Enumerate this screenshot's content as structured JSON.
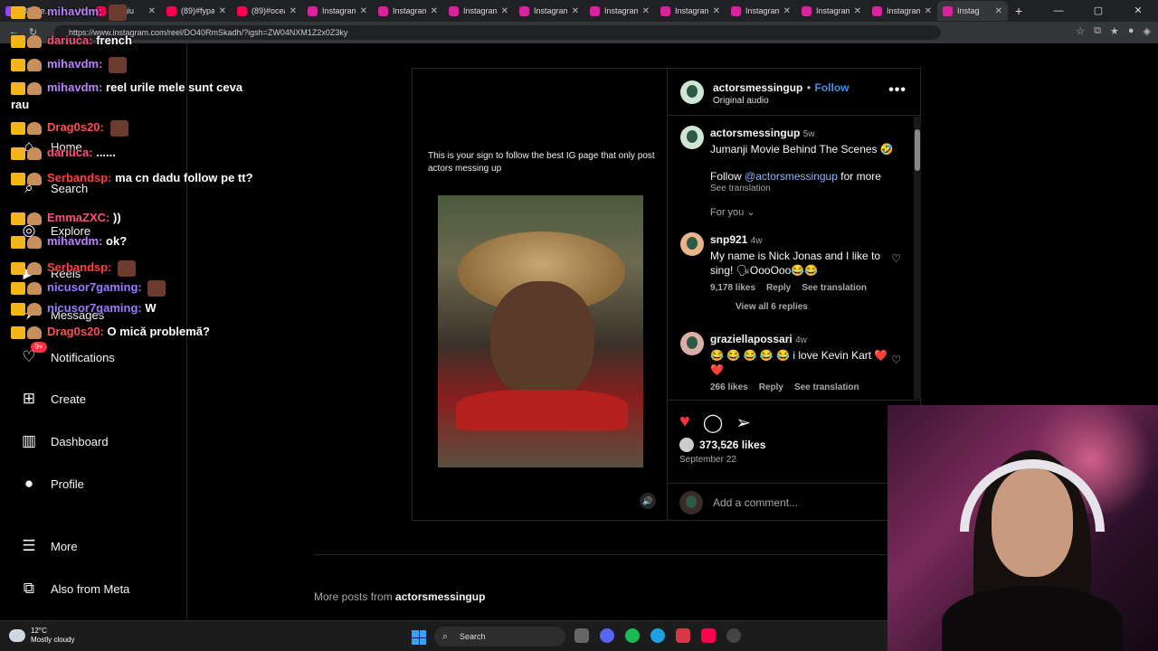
{
  "browser": {
    "tabs": [
      {
        "label": "(88)Ne...",
        "color": "#9146ff"
      },
      {
        "label": "Sergiu",
        "color": "#ff0050"
      },
      {
        "label": "(89)#fypag",
        "color": "#ff0050"
      },
      {
        "label": "(89)#ocea",
        "color": "#ff0050"
      },
      {
        "label": "Instagram",
        "color": "#d6249f"
      },
      {
        "label": "Instagram",
        "color": "#d6249f"
      },
      {
        "label": "Instagram",
        "color": "#d6249f"
      },
      {
        "label": "Instagram",
        "color": "#d6249f"
      },
      {
        "label": "Instagram",
        "color": "#d6249f"
      },
      {
        "label": "Instagram",
        "color": "#d6249f"
      },
      {
        "label": "Instagram",
        "color": "#d6249f"
      },
      {
        "label": "Instagram",
        "color": "#d6249f"
      },
      {
        "label": "Instagram",
        "color": "#d6249f"
      },
      {
        "label": "Instag",
        "color": "#d6249f"
      }
    ],
    "new_tab": "+",
    "url": "https://www.instagram.com/reel/DO40RmSkadh/?igsh=ZW04NXM1Z2x0Z3ky"
  },
  "sidebar": {
    "logo": "Instagram",
    "items": [
      {
        "label": "Home",
        "icon": "home-icon",
        "glyph": "⌂"
      },
      {
        "label": "Search",
        "icon": "search-icon",
        "glyph": "⌕"
      },
      {
        "label": "Explore",
        "icon": "explore-icon",
        "glyph": "◎"
      },
      {
        "label": "Reels",
        "icon": "reels-icon",
        "glyph": "▶"
      },
      {
        "label": "Messages",
        "icon": "messages-icon",
        "glyph": "✈"
      },
      {
        "label": "Notifications",
        "icon": "heart-icon",
        "glyph": "♡"
      },
      {
        "label": "Create",
        "icon": "plus-square-icon",
        "glyph": "⊞"
      },
      {
        "label": "Dashboard",
        "icon": "dashboard-icon",
        "glyph": "▥"
      },
      {
        "label": "Profile",
        "icon": "avatar-icon",
        "glyph": "●"
      },
      {
        "label": "More",
        "icon": "menu-icon",
        "glyph": "☰"
      },
      {
        "label": "Also from Meta",
        "icon": "meta-icon",
        "glyph": "⧉"
      }
    ],
    "messages_badge": "9+"
  },
  "chat": [
    {
      "user": "mihavdm:",
      "text": "",
      "color": "#b983ff",
      "emote": true
    },
    {
      "user": "dariuca:",
      "text": "french",
      "color": "#ff4f7a",
      "emote": false
    },
    {
      "user": "mihavdm:",
      "text": "",
      "color": "#b983ff",
      "emote": true
    },
    {
      "user": "mihavdm:",
      "text": "reel urile mele sunt ceva rau",
      "color": "#b983ff",
      "emote": false
    },
    {
      "user": "Drag0s20:",
      "text": "",
      "color": "#ff4f4f",
      "emote": true
    },
    {
      "user": "dariuca:",
      "text": "......",
      "color": "#ff4f7a",
      "emote": false
    },
    {
      "user": "Serbandsp:",
      "text": "ma cn dadu follow pe tt?",
      "color": "#ff4040",
      "emote": false
    },
    {
      "user": "EmmaZXC:",
      "text": "))",
      "color": "#ff4f7a",
      "emote": false
    },
    {
      "user": "mihavdm:",
      "text": "ok?",
      "color": "#b983ff",
      "emote": false
    },
    {
      "user": "Serbandsp:",
      "text": "",
      "color": "#ff4040",
      "emote": true
    },
    {
      "user": "nicusor7gaming:",
      "text": "",
      "color": "#9a7cff",
      "emote": true
    },
    {
      "user": "nicusor7gaming:",
      "text": "W",
      "color": "#9a7cff",
      "emote": false
    },
    {
      "user": "Drag0s20:",
      "text": "O mică problemă?",
      "color": "#ff4f4f",
      "emote": false
    }
  ],
  "post": {
    "overlay_caption": "This is your sign to follow the best IG page that only post actors messing up",
    "username": "actorsmessingup",
    "follow": "Follow",
    "separator": "•",
    "audio": "Original audio",
    "more": "•••",
    "caption": {
      "username": "actorsmessingup",
      "age": "5w",
      "line1": "Jumanji Movie Behind The Scenes 🤣",
      "line2_prefix": "Follow ",
      "line2_mention": "@actorsmessingup",
      "line2_suffix": " for more",
      "see_translation": "See translation"
    },
    "for_you": "For you ⌄",
    "comments": [
      {
        "user": "snp921",
        "age": "4w",
        "text": "My name is Nick Jonas and I like to sing! 🗣OooOoo😂😂",
        "likes": "9,178 likes",
        "reply": "Reply",
        "translate": "See translation",
        "view_replies": "View all 6 replies"
      },
      {
        "user": "graziellapossari",
        "age": "4w",
        "text": "😂 😂 😂 😂 😂  i love Kevin Kart ❤️ ❤️",
        "likes": "266 likes",
        "reply": "Reply",
        "translate": "See translation"
      }
    ],
    "likes_count": "373,526 likes",
    "date": "September 22",
    "add_comment_placeholder": "Add a comment..."
  },
  "more_posts": {
    "prefix": "More posts from ",
    "user": "actorsmessingup"
  },
  "taskbar": {
    "temp": "12°C",
    "condition": "Mostly cloudy",
    "search": "Search"
  },
  "colors": {
    "like": "#ff3040",
    "link": "#4a90e2",
    "bg": "#000000"
  }
}
